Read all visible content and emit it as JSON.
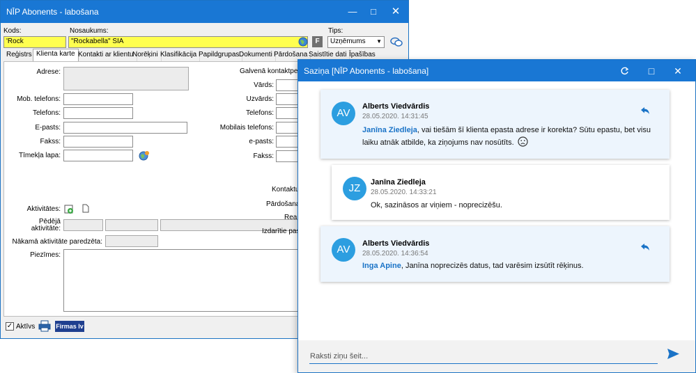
{
  "main_window": {
    "title": "NĪP Abonents - labošana",
    "fields": {
      "kods_label": "Kods:",
      "kods_value": "'Rock",
      "nosaukums_label": "Nosaukums:",
      "nosaukums_value": "\"Rockabella\" SIA",
      "tips_label": "Tips:",
      "tips_value": "Uzņēmums",
      "f_button": "F"
    },
    "tabs": [
      "Reģistrs",
      "Klienta karte",
      "Kontakti ar klientu",
      "Norēķini",
      "Klasifikācija",
      "Papildgrupas",
      "Dokumenti",
      "Pārdošana",
      "Saistītie dati",
      "Īpašības"
    ],
    "form_labels": {
      "adrese": "Adrese:",
      "mob": "Mob. telefons:",
      "telefons": "Telefons:",
      "epasts": "E-pasts:",
      "fakss": "Fakss:",
      "timekla": "Tīmekļa lapa:",
      "aktivitates": "Aktivitātes:",
      "pedeja_1": "Pēdējā",
      "pedeja_2": "aktivitāte:",
      "nakama": "Nākamā aktivitāte paredzēta:",
      "piezimes": "Piezīmes:"
    },
    "contact_labels": {
      "galvena": "Galvenā kontaktperso",
      "vards": "Vārds:",
      "uzvards": "Uzvārds:",
      "telefons": "Telefons:",
      "mobilais": "Mobilais telefons:",
      "epasts": "e-pasts:",
      "fakss": "Fakss:",
      "kontaktu": "Kontaktu",
      "pardosanas": "Pārdošanas",
      "reali": "Reali",
      "izdaritie": "Izdarītie pasū"
    },
    "footer": {
      "aktivs_label": "Aktīvs",
      "firmas_label": "Firmas lv"
    }
  },
  "chat_window": {
    "title": "Saziņa [NĪP Abonents - labošana]",
    "messages": [
      {
        "initials": "AV",
        "author": "Alberts Viedvārdis",
        "time": "28.05.2020. 14:31:45",
        "mention": "Janīna Ziedleja",
        "text": ", vai tiešām šī klienta epasta adrese ir korekta? Sūtu epastu, bet visu laiku atnāk atbilde, ka ziņojums nav nosūtīts."
      },
      {
        "initials": "JZ",
        "author": "Janīna Ziedleja",
        "time": "28.05.2020. 14:33:21",
        "mention": "",
        "text": "Ok, sazināsos ar viņiem - noprecizēšu."
      },
      {
        "initials": "AV",
        "author": "Alberts Viedvārdis",
        "time": "28.05.2020. 14:36:54",
        "mention": "Inga Apine",
        "text": ", Janīna noprecizēs datus, tad varēsim izsūtīt rēķinus."
      }
    ],
    "input_placeholder": "Raksti ziņu šeit..."
  }
}
